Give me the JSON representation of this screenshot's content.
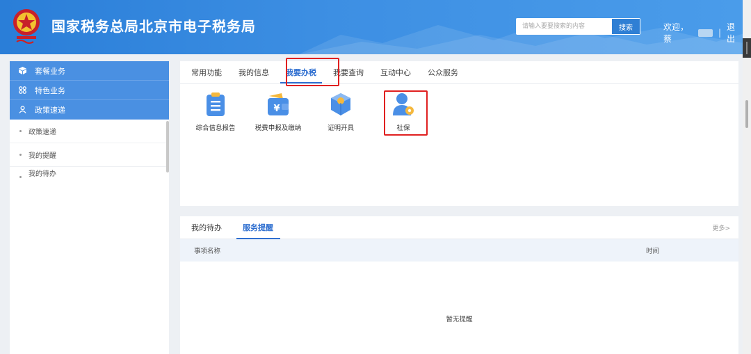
{
  "header": {
    "title": "国家税务总局北京市电子税务局",
    "search_placeholder": "请输入要要搜索的内容",
    "search_button": "搜索",
    "welcome": "欢迎，蔡",
    "separator": "|",
    "logout": "退出",
    "brand_color": "#2a7ed8"
  },
  "sidebar": {
    "sections": [
      {
        "label": "套餐业务",
        "icon": "cube-icon"
      },
      {
        "label": "特色业务",
        "icon": "grid-icon"
      },
      {
        "label": "政策速递",
        "icon": "user-icon"
      }
    ],
    "items": [
      {
        "label": "政策速递"
      },
      {
        "label": "我的提醒"
      },
      {
        "label": "我的待办"
      }
    ]
  },
  "main_tabs": {
    "tabs": [
      {
        "label": "常用功能"
      },
      {
        "label": "我的信息"
      },
      {
        "label": "我要办税",
        "active": true
      },
      {
        "label": "我要查询"
      },
      {
        "label": "互动中心"
      },
      {
        "label": "公众服务"
      }
    ]
  },
  "functions": [
    {
      "label": "综合信息报告",
      "icon": "clipboard-icon"
    },
    {
      "label": "税费申报及缴纳",
      "icon": "yuan-wallet-icon"
    },
    {
      "label": "证明开具",
      "icon": "box-icon"
    },
    {
      "label": "社保",
      "icon": "social-security-user-icon"
    }
  ],
  "reminders": {
    "tabs": [
      {
        "label": "我的待办"
      },
      {
        "label": "服务提醒",
        "active": true
      }
    ],
    "more": "更多>",
    "columns": {
      "name": "事项名称",
      "time": "时间"
    },
    "empty": "暂无提醒"
  },
  "colors": {
    "active_tab": "#2f6fd0",
    "highlight": "#e02020",
    "sidebar_head": "#4a90e2"
  }
}
